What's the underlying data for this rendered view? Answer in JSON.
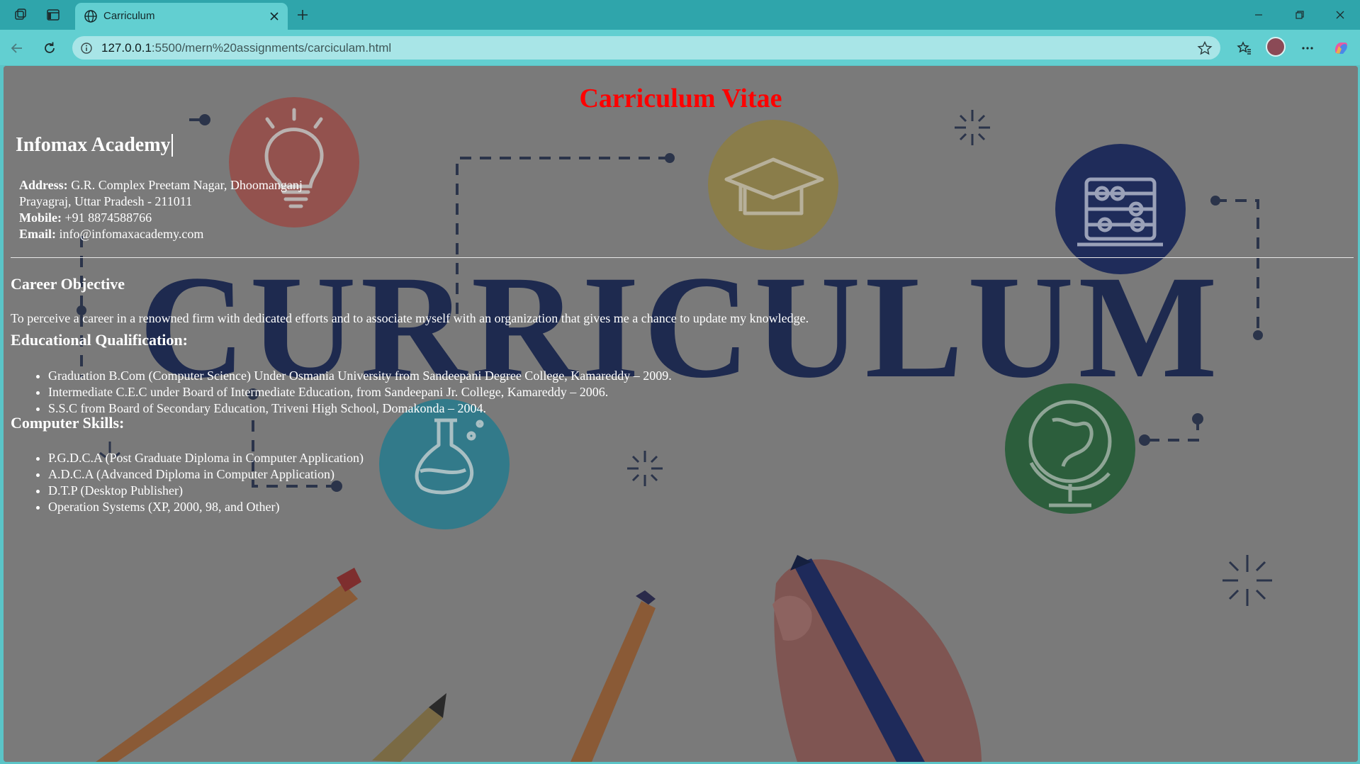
{
  "browser": {
    "tab_title": "Carriculum",
    "url_host": "127.0.0.1",
    "url_rest": ":5500/mern%20assignments/carciculam.html",
    "accent": "#2fa5ab",
    "toolbar_color": "#62cfd1"
  },
  "page": {
    "title": "Carriculum Vitae",
    "title_color": "#ff0000",
    "org_name": "Infomax Academy",
    "address_label": "Address:",
    "address_line1": "G.R. Complex Preetam Nagar, Dhoomanganj",
    "address_line2": "Prayagraj, Uttar Pradesh - 211011",
    "mobile_label": "Mobile:",
    "mobile": "+91 8874588766",
    "email_label": "Email:",
    "email": "info@infomaxacademy.com",
    "career_heading": "Career Objective",
    "career_text": "To perceive a career in a renowned firm with dedicated efforts and to associate myself with an organization that gives me a chance to update my knowledge.",
    "education_heading": "Educational Qualification:",
    "education": [
      "Graduation B.Com (Computer Science) Under Osmania University from Sandeepani Degree College, Kamareddy – 2009.",
      "Intermediate C.E.C under Board of Intermediate Education, from Sandeepani Jr. College, Kamareddy – 2006.",
      "S.S.C from Board of Secondary Education, Triveni High School, Domakonda – 2004."
    ],
    "skills_heading": "Computer Skills:",
    "skills": [
      "P.G.D.C.A (Post Graduate Diploma in Computer Application)",
      "A.D.C.A (Advanced Diploma in Computer Application)",
      "D.T.P (Desktop Publisher)",
      "Operation Systems (XP, 2000, 98, and Other)"
    ],
    "background_word": "CURRICULUM"
  }
}
